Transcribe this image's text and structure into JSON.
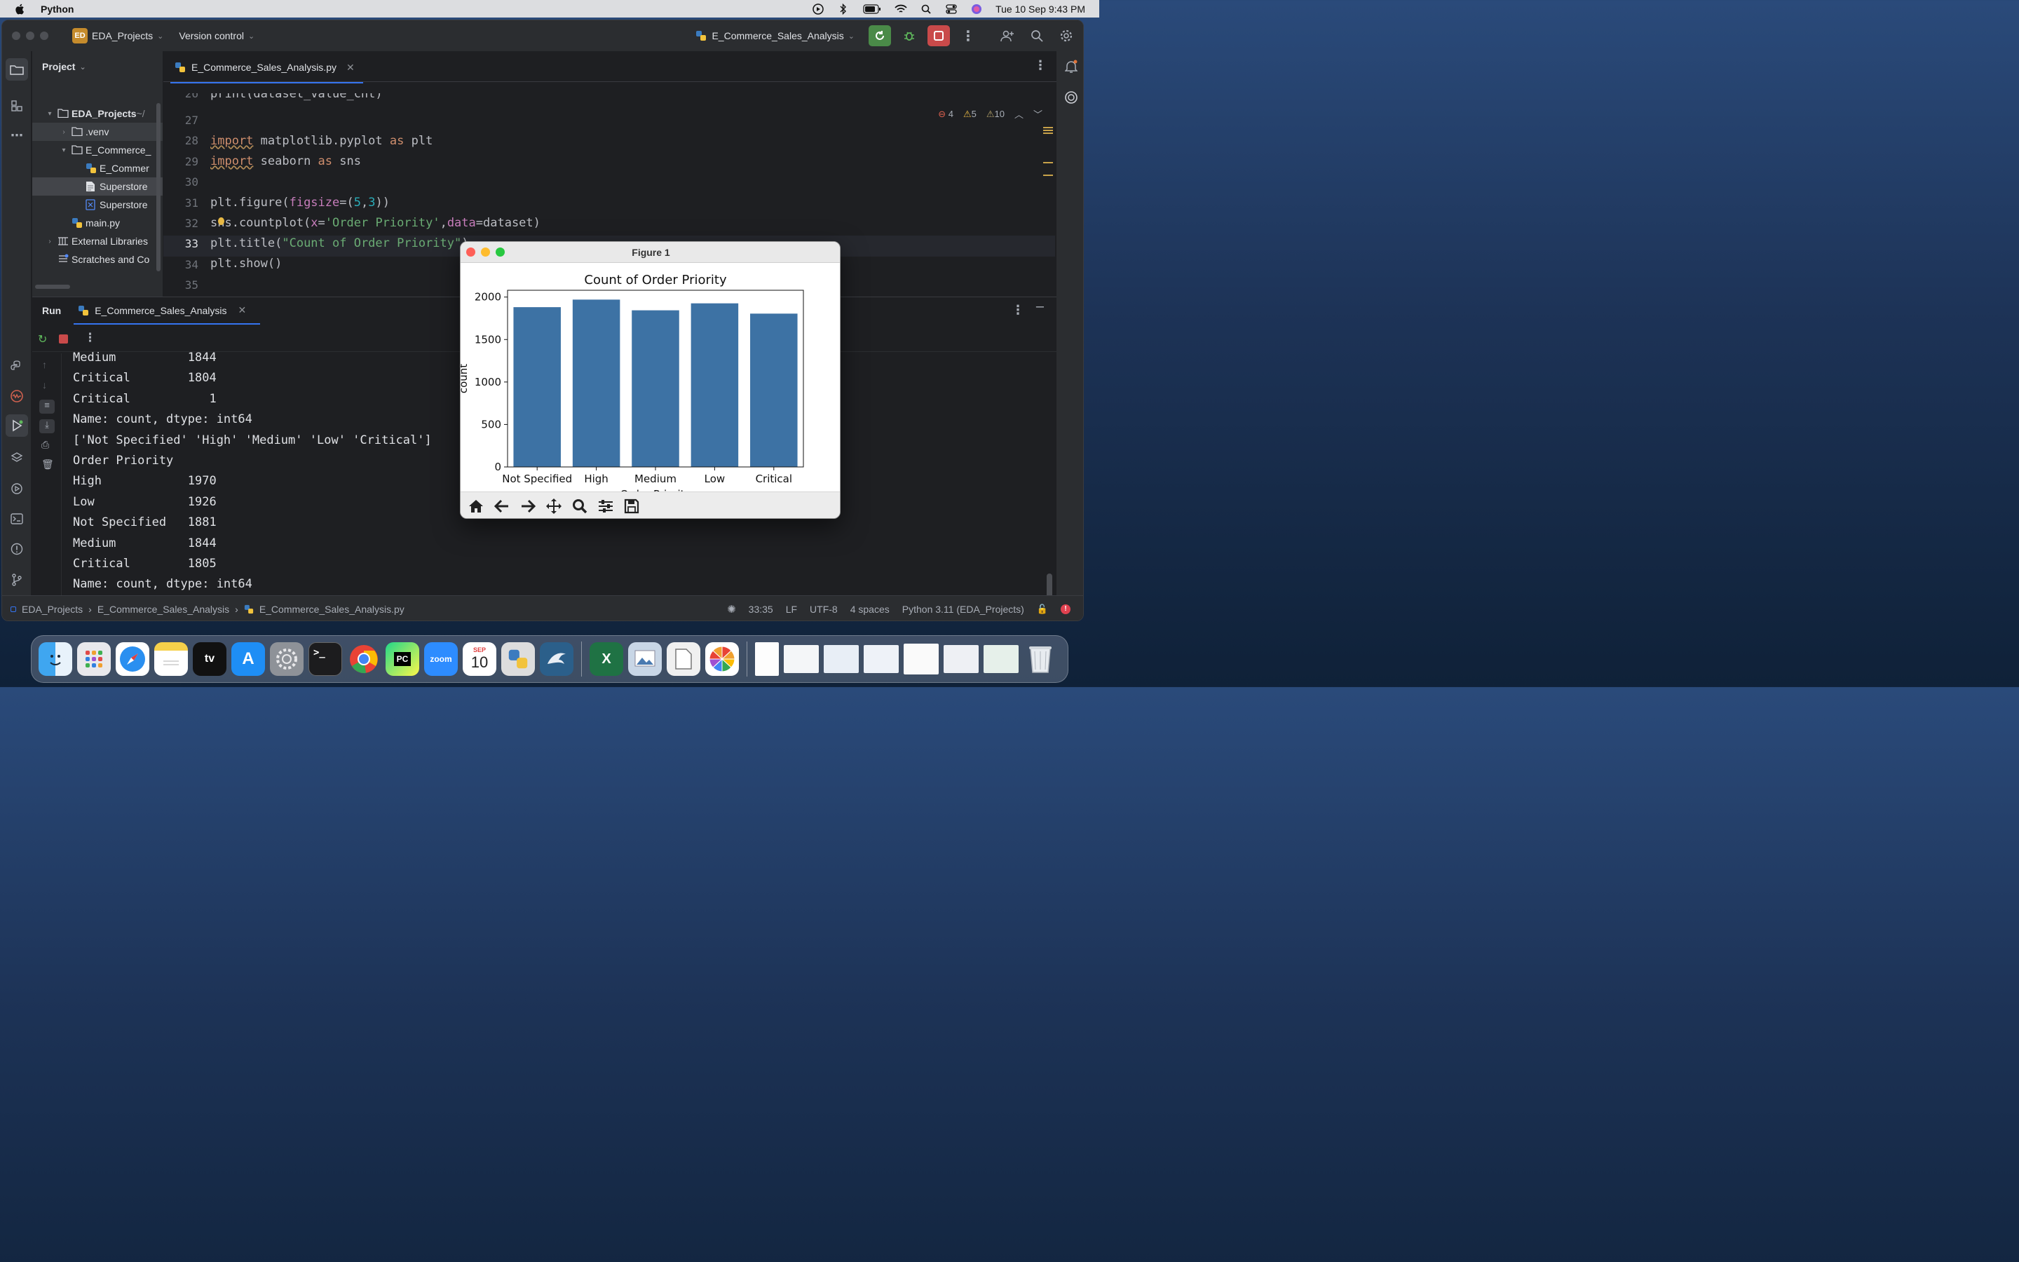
{
  "menubar": {
    "app_name": "Python",
    "datetime": "Tue 10 Sep  9:43 PM"
  },
  "titlebar": {
    "project_badge": "ED",
    "project_name": "EDA_Projects",
    "version_control": "Version control",
    "run_config": "E_Commerce_Sales_Analysis"
  },
  "project_panel": {
    "header": "Project",
    "tree": [
      {
        "label": "EDA_Projects",
        "suffix": "~/",
        "indent": 0,
        "twisty": "▾",
        "icon": "folder-icon"
      },
      {
        "label": ".venv",
        "indent": 1,
        "twisty": "›",
        "icon": "folder-icon"
      },
      {
        "label": "E_Commerce_",
        "indent": 1,
        "twisty": "▾",
        "icon": "folder-icon"
      },
      {
        "label": "E_Commer",
        "indent": 2,
        "twisty": "",
        "icon": "python-file-icon"
      },
      {
        "label": "Superstore",
        "indent": 2,
        "twisty": "",
        "icon": "text-file-icon"
      },
      {
        "label": "Superstore",
        "indent": 2,
        "twisty": "",
        "icon": "spreadsheet-file-icon"
      },
      {
        "label": "main.py",
        "indent": 1,
        "twisty": "",
        "icon": "python-file-icon"
      },
      {
        "label": "External Libraries",
        "indent": 0,
        "twisty": "›",
        "icon": "library-icon"
      },
      {
        "label": "Scratches and Co",
        "indent": 0,
        "twisty": "",
        "icon": "scratches-icon"
      }
    ]
  },
  "editor": {
    "tab_label": "E_Commerce_Sales_Analysis.py",
    "inspections": {
      "errors": "4",
      "warnings": "5",
      "weak_warnings": "10"
    },
    "line_numbers": [
      "26",
      "27",
      "28",
      "29",
      "30",
      "31",
      "32",
      "33",
      "34",
      "35"
    ],
    "partial_line": "print(dataset_value_cnt)"
  },
  "run_panel": {
    "title": "Run",
    "tab_label": "E_Commerce_Sales_Analysis",
    "output": [
      "Medium          1844",
      "Critical        1804",
      "Critical           1",
      "Name: count, dtype: int64",
      "['Not Specified' 'High' 'Medium' 'Low' 'Critical']",
      "Order Priority",
      "High            1970",
      "Low             1926",
      "Not Specified   1881",
      "Medium          1844",
      "Critical        1805",
      "Name: count, dtype: int64"
    ]
  },
  "statusbar": {
    "crumbs": [
      "EDA_Projects",
      "E_Commerce_Sales_Analysis",
      "E_Commerce_Sales_Analysis.py"
    ],
    "position": "33:35",
    "line_sep": "LF",
    "encoding": "UTF-8",
    "indent": "4 spaces",
    "interpreter": "Python 3.11 (EDA_Projects)"
  },
  "figure": {
    "window_title": "Figure 1",
    "xlabel_partial": "Order Priority"
  },
  "chart_data": {
    "type": "bar",
    "title": "Count of Order Priority",
    "xlabel": "Order Priority",
    "ylabel": "count",
    "categories": [
      "Not Specified",
      "High",
      "Medium",
      "Low",
      "Critical"
    ],
    "values": [
      1881,
      1970,
      1844,
      1926,
      1805
    ],
    "ylim": [
      0,
      2080
    ],
    "yticks": [
      0,
      500,
      1000,
      1500,
      2000
    ],
    "ytick_labels": [
      "0",
      "500",
      "1000",
      "1500",
      "2000"
    ],
    "bar_color": "#3d72a4",
    "grid": false
  },
  "dock": {
    "calendar_month": "SEP",
    "calendar_day": "10",
    "tv_label": "tv",
    "zoom_label": "zoom",
    "pycharm_label": "PC"
  }
}
